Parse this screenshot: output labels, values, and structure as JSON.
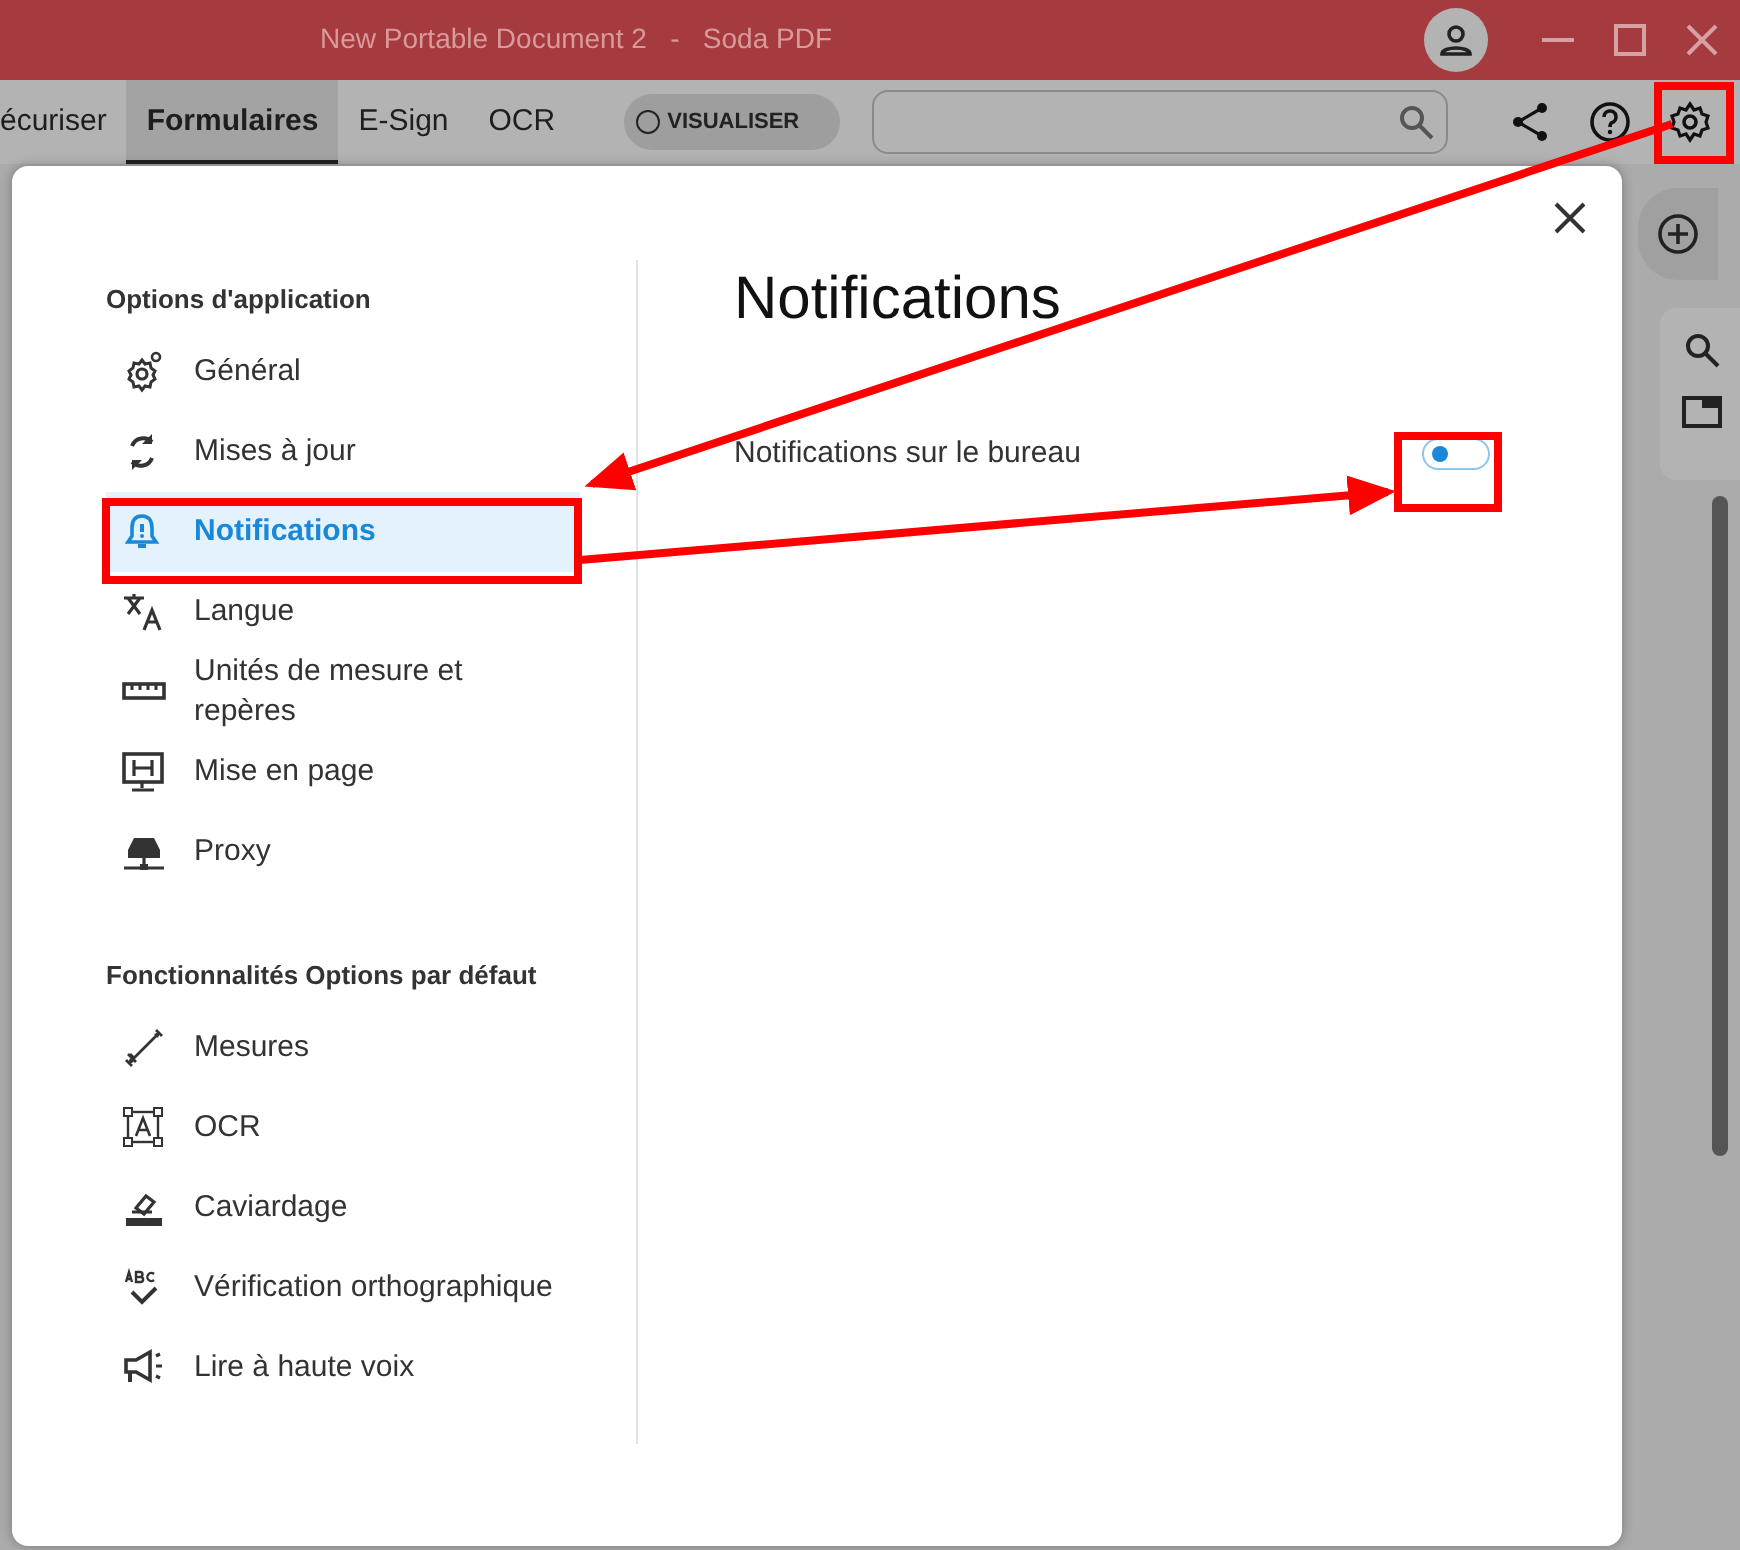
{
  "window": {
    "title": "New Portable Document 2   -   Soda PDF"
  },
  "tabs": [
    {
      "label": "écuriser",
      "selected": false
    },
    {
      "label": "Formulaires",
      "selected": true
    },
    {
      "label": "E-Sign",
      "selected": false
    },
    {
      "label": "OCR",
      "selected": false
    }
  ],
  "view_toggle": {
    "label": "VISUALISER",
    "on": false
  },
  "dialog": {
    "sections": [
      {
        "heading": "Options d'application",
        "items": [
          {
            "label": "Général",
            "selected": false
          },
          {
            "label": "Mises à jour",
            "selected": false
          },
          {
            "label": "Notifications",
            "selected": true
          },
          {
            "label": "Langue",
            "selected": false
          },
          {
            "label": "Unités de mesure et repères",
            "selected": false
          },
          {
            "label": "Mise en page",
            "selected": false
          },
          {
            "label": "Proxy",
            "selected": false
          }
        ]
      },
      {
        "heading": "Fonctionnalités Options par défaut",
        "items": [
          {
            "label": "Mesures",
            "selected": false
          },
          {
            "label": "OCR",
            "selected": false
          },
          {
            "label": "Caviardage",
            "selected": false
          },
          {
            "label": "Vérification orthographique",
            "selected": false
          },
          {
            "label": "Lire à haute voix",
            "selected": false
          }
        ]
      }
    ],
    "title": "Notifications",
    "settings": [
      {
        "label": "Notifications sur le bureau",
        "on": false
      }
    ]
  }
}
